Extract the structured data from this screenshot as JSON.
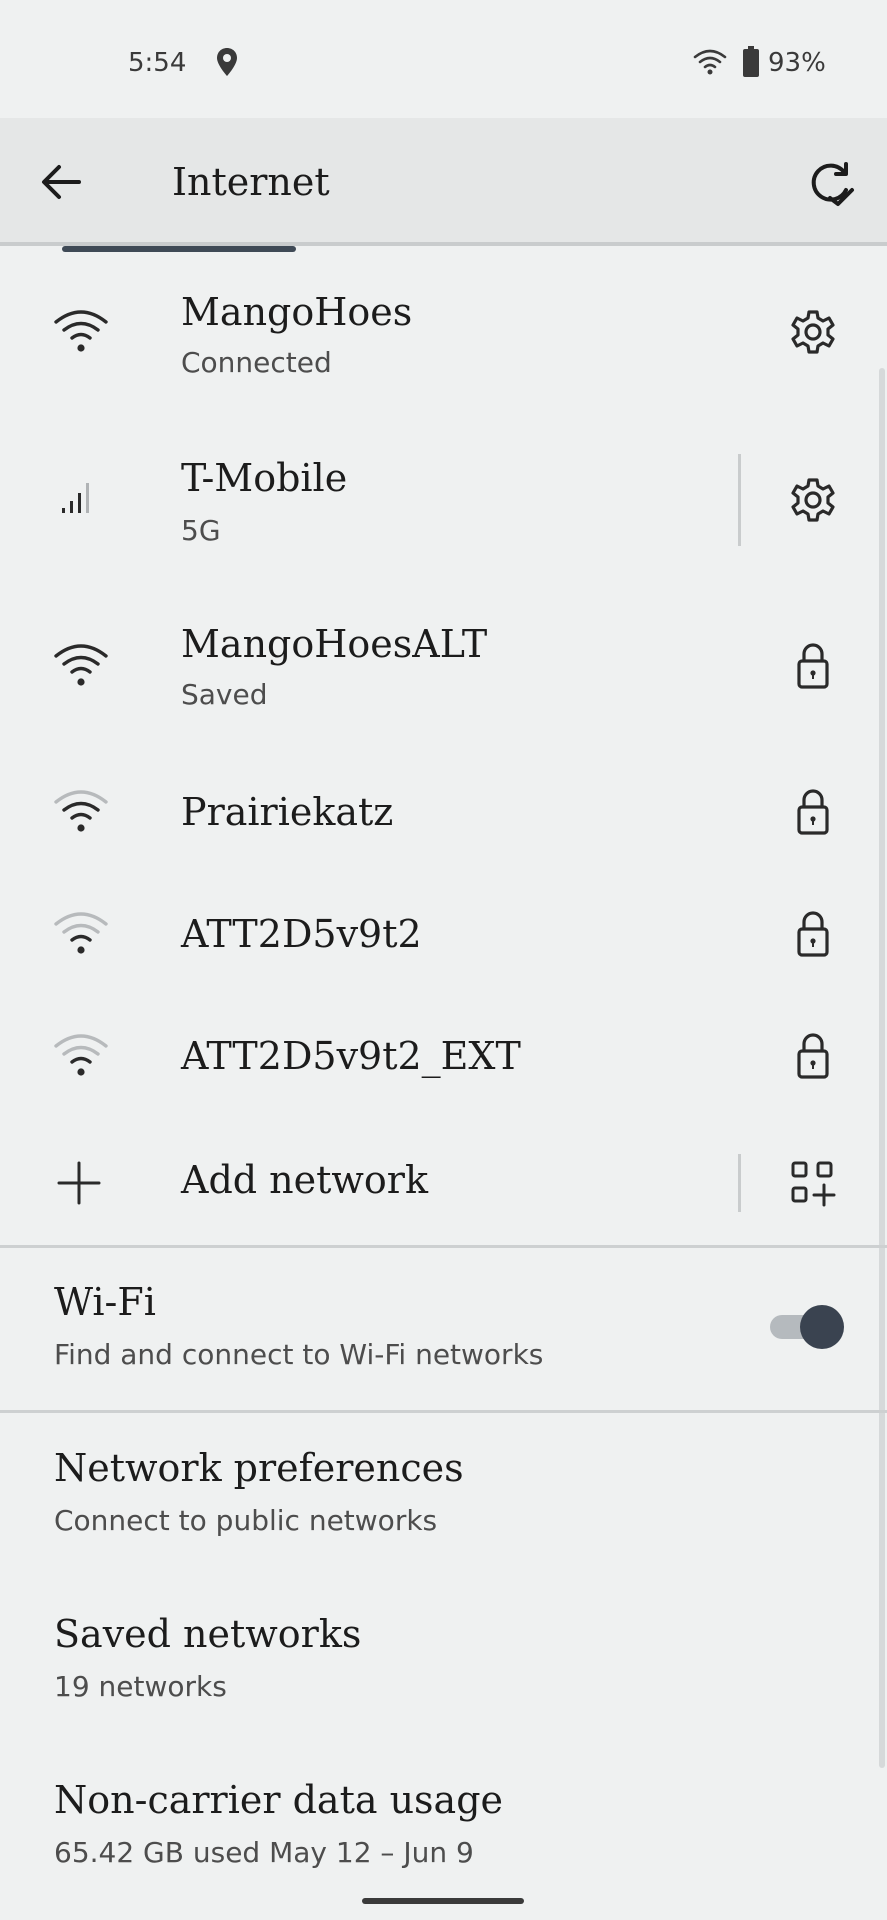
{
  "status_bar": {
    "time": "5:54",
    "battery": "93%",
    "icons": [
      "location-icon",
      "wifi-icon",
      "battery-icon"
    ]
  },
  "app_bar": {
    "title": "Internet",
    "back_icon": "arrow-left-icon",
    "action_icon": "refresh-icon"
  },
  "networks": [
    {
      "name": "MangoHoes",
      "subtitle": "Connected",
      "icon": "wifi-full-icon",
      "action": "gear-icon"
    },
    {
      "name": "T-Mobile",
      "subtitle": "5G",
      "icon": "cell-signal-icon",
      "action": "gear-icon"
    },
    {
      "name": "MangoHoesALT",
      "subtitle": "Saved",
      "icon": "wifi-full-icon",
      "action": "lock-icon"
    },
    {
      "name": "Prairiekatz",
      "icon": "wifi-medium-icon",
      "action": "lock-icon"
    },
    {
      "name": "ATT2D5v9t2",
      "icon": "wifi-weak-icon",
      "action": "lock-icon"
    },
    {
      "name": "ATT2D5v9t2_EXT",
      "icon": "wifi-weak-icon",
      "action": "lock-icon"
    }
  ],
  "add_network": {
    "label": "Add network",
    "icon": "plus-icon",
    "action": "qr-scan-icon"
  },
  "wifi": {
    "title": "Wi-Fi",
    "subtitle": "Find and connect to Wi-Fi networks",
    "enabled": true
  },
  "preferences": [
    {
      "title": "Network preferences",
      "subtitle": "Connect to public networks"
    },
    {
      "title": "Saved networks",
      "subtitle": "19 networks"
    },
    {
      "title": "Non-carrier data usage",
      "subtitle": "65.42 GB used May 12 – Jun 9"
    }
  ],
  "colors": {
    "background": "#eff1f1",
    "app_bar": "#e5e7e7",
    "accent": "#3a4350",
    "text_primary": "#1c1c1c",
    "text_secondary": "#4d4d4d"
  }
}
